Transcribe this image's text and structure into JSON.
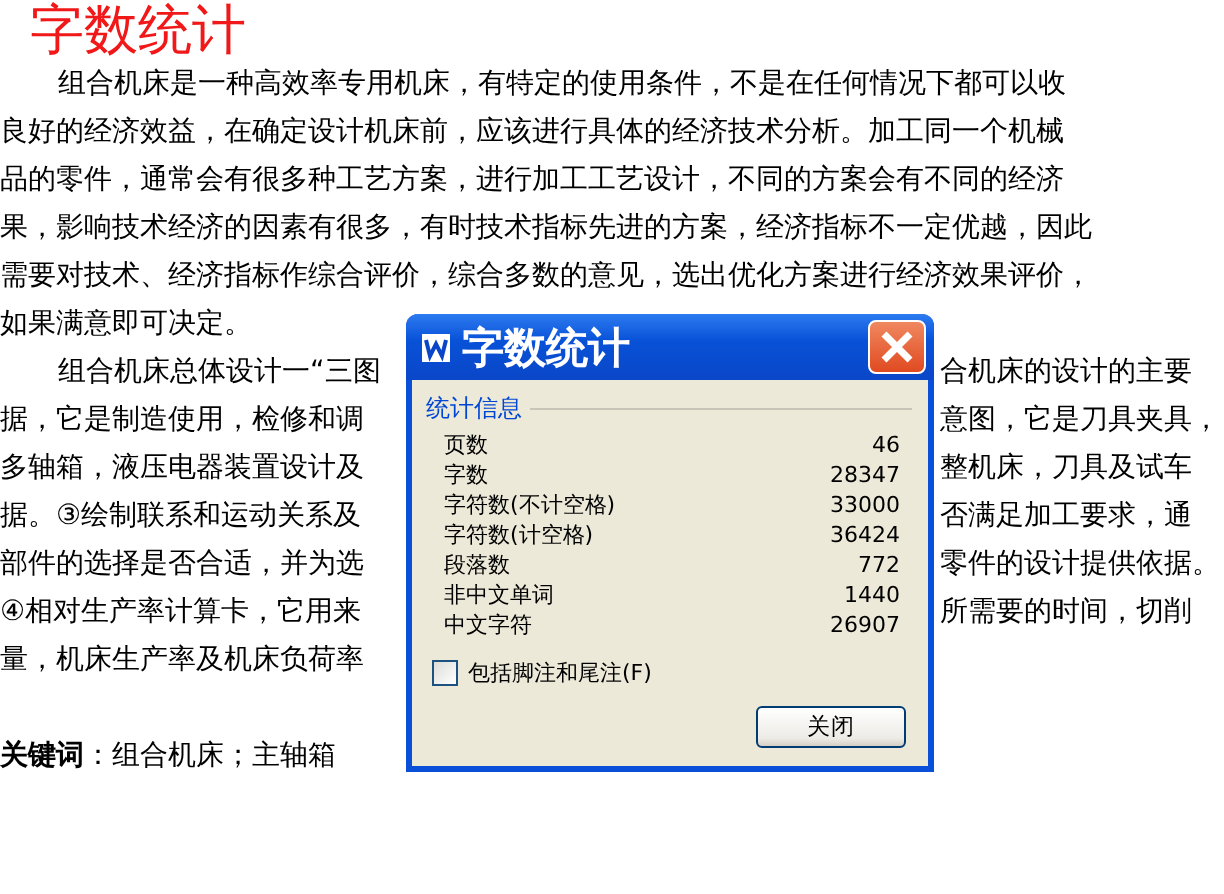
{
  "caption": "字数统计",
  "document": {
    "lines": [
      {
        "left": "组合机床是一种高效率专用机床，有特定的使用条件，不是在任何情况下都可以收",
        "indent": true
      },
      {
        "left": "良好的经济效益，在确定设计机床前，应该进行具体的经济技术分析。加工同一个机械"
      },
      {
        "left": "品的零件，通常会有很多种工艺方案，进行加工工艺设计，不同的方案会有不同的经济"
      },
      {
        "left": "果，影响技术经济的因素有很多，有时技术指标先进的方案，经济指标不一定优越，因此"
      },
      {
        "left": "需要对技术、经济指标作综合评价，综合多数的意见，选出优化方案进行经济效果评价，"
      },
      {
        "left": "如果满意即可决定。"
      },
      {
        "left": "组合机床总体设计一“三图",
        "right": "合机床的设计的主要",
        "indent": true
      },
      {
        "left": "据，它是制造使用，检修和调",
        "right": "意图，它是刀具夹具，"
      },
      {
        "left": "多轴箱，液压电器装置设计及",
        "right": "整机床，刀具及试车"
      },
      {
        "left": "据。③绘制联系和运动关系及",
        "right": "否满足加工要求，通"
      },
      {
        "left": "部件的选择是否合适，并为选",
        "right": "零件的设计提供依据。"
      },
      {
        "left": "④相对生产率计算卡，它用来",
        "right": "所需要的时间，切削"
      },
      {
        "left": "量，机床生产率及机床负荷率"
      }
    ],
    "keywords": "**关键词**：组合机床；主轴箱"
  },
  "dialog": {
    "title": "字数统计",
    "section": "统计信息",
    "stats": [
      {
        "label": "页数",
        "value": "46"
      },
      {
        "label": "字数",
        "value": "28347"
      },
      {
        "label": "字符数(不计空格)",
        "value": "33000"
      },
      {
        "label": "字符数(计空格)",
        "value": "36424"
      },
      {
        "label": "段落数",
        "value": "772"
      },
      {
        "label": "非中文单词",
        "value": "1440"
      },
      {
        "label": "中文字符",
        "value": "26907"
      }
    ],
    "checkbox": {
      "label": "包括脚注和尾注(F)",
      "checked": false
    },
    "button": "关闭"
  }
}
